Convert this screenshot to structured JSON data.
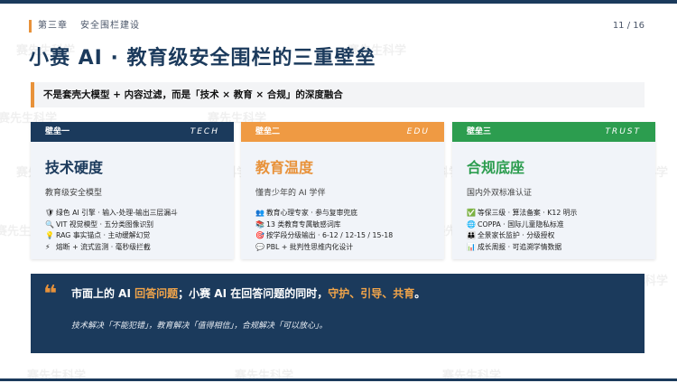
{
  "header": {
    "chapter_label": "第三章",
    "chapter_title": "安全围栏建设",
    "page_indicator": "11 / 16"
  },
  "title": "小赛 AI · 教育级安全围栏的三重壁垒",
  "banner": "不是套壳大模型 + 内容过滤，而是「技术 × 教育 × 合规」的深度融合",
  "watermark_text": "赛先生科学",
  "cards": [
    {
      "tag": "壁垒一",
      "en": "TECH",
      "title": "技术硬度",
      "subtitle": "教育级安全模型",
      "items": [
        {
          "icon": "🛡",
          "text": "绿色 AI 引擎 · 输入-处理-输出三层漏斗"
        },
        {
          "icon": "🔍",
          "text": "VIT 视觉模型 · 五分类图像识别"
        },
        {
          "icon": "💡",
          "text": "RAG 事实锚点 · 主动缓解幻觉"
        },
        {
          "icon": "⚡",
          "text": "熔断 + 流式监测 · 毫秒级拦截"
        }
      ]
    },
    {
      "tag": "壁垒二",
      "en": "EDU",
      "title": "教育温度",
      "subtitle": "懂青少年的 AI 学伴",
      "items": [
        {
          "icon": "👥",
          "text": "教育心理专家 · 参与复审兜底"
        },
        {
          "icon": "📚",
          "text": "13 类教育专属敏感词库"
        },
        {
          "icon": "🎯",
          "text": "按学段分级输出 · 6-12 / 12-15 / 15-18"
        },
        {
          "icon": "💬",
          "text": "PBL + 批判性思维内化设计"
        }
      ]
    },
    {
      "tag": "壁垒三",
      "en": "TRUST",
      "title": "合规底座",
      "subtitle": "国内外双标准认证",
      "items": [
        {
          "icon": "✅",
          "text": "等保三级 · 算法备案 · K12 明示"
        },
        {
          "icon": "🌐",
          "text": "COPPA · 国际儿童隐私标准"
        },
        {
          "icon": "👪",
          "text": "全景家长监护 · 分级授权"
        },
        {
          "icon": "📊",
          "text": "成长周报 · 可追溯学情数据"
        }
      ]
    }
  ],
  "quote": {
    "mark": "❝",
    "part1": "市面上的 AI ",
    "highlight1": "回答问题",
    "part2": "；小赛 AI 在回答问题的同时，",
    "highlight2": "守护、引导、共育",
    "part3": "。",
    "sub": "技术解决「不能犯错」，教育解决「值得相信」，合规解决「可以放心」。"
  },
  "colors": {
    "navy": "#1b3a5c",
    "orange": "#e8923a",
    "green": "#2c9d4f"
  }
}
